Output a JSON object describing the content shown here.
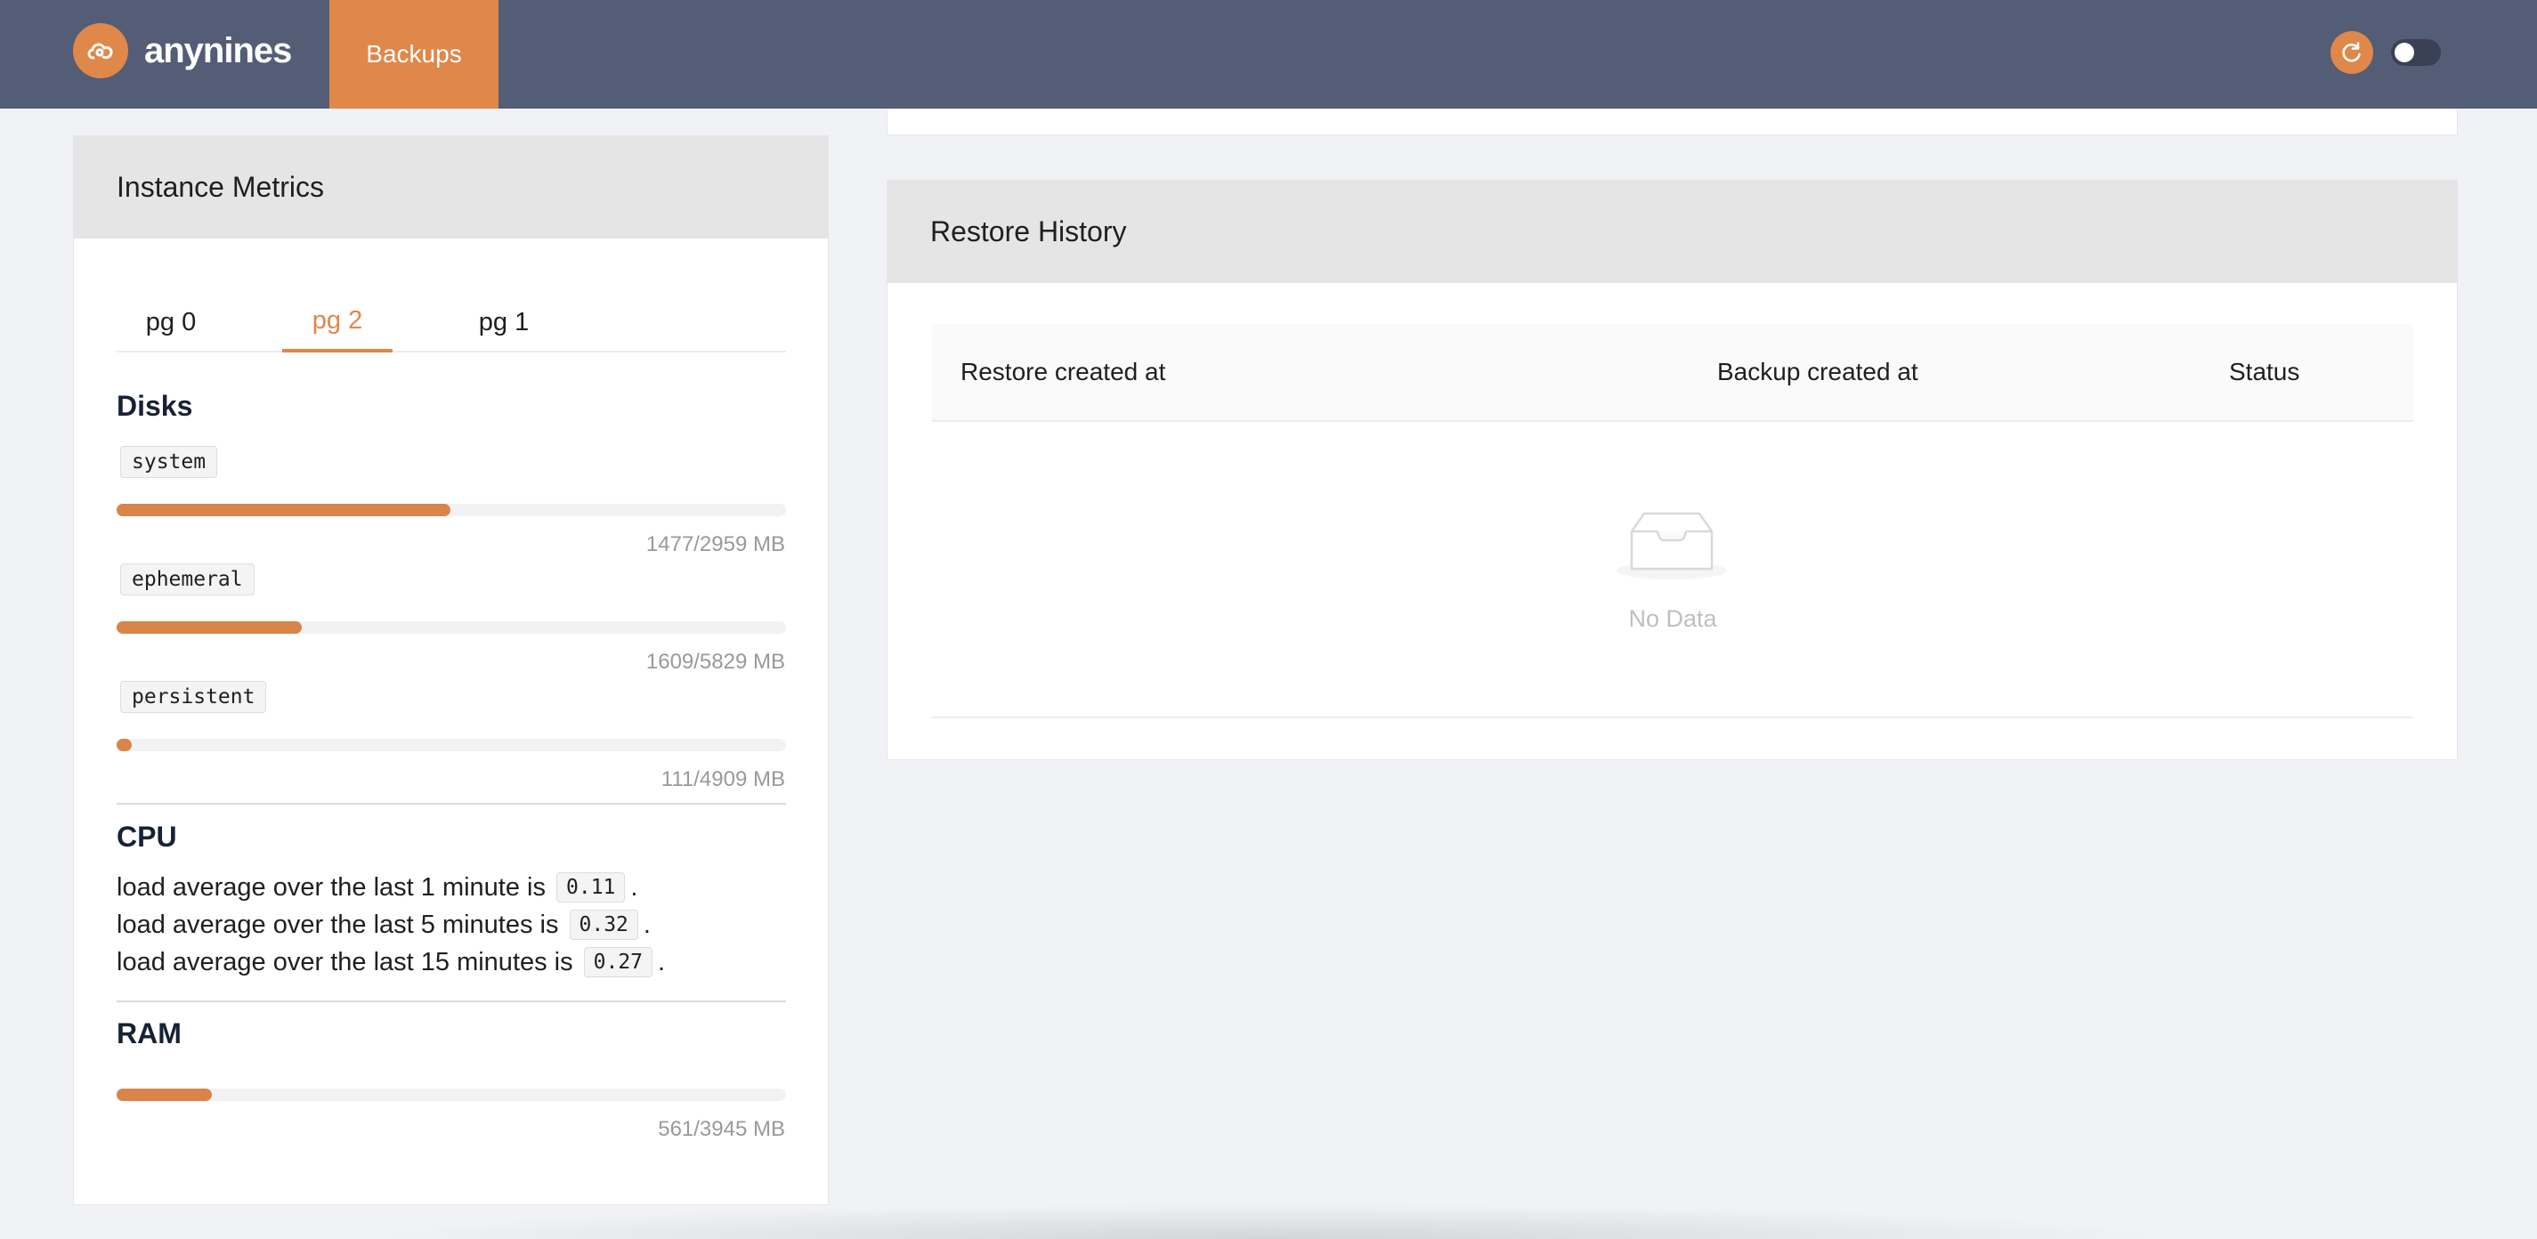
{
  "header": {
    "brand": "anynines",
    "nav_backups": "Backups",
    "refresh_icon": "refresh-icon",
    "theme_toggle_icon": "toggle-icon",
    "colors": {
      "topbar": "#535d76",
      "accent": "#e0874a"
    }
  },
  "metrics": {
    "title": "Instance Metrics",
    "tabs": [
      {
        "label": "pg 0",
        "active": false
      },
      {
        "label": "pg 2",
        "active": true
      },
      {
        "label": "pg 1",
        "active": false
      }
    ],
    "disks": {
      "title": "Disks",
      "items": [
        {
          "name": "system",
          "used": 1477,
          "total": 2959,
          "caption": "1477/2959 MB"
        },
        {
          "name": "ephemeral",
          "used": 1609,
          "total": 5829,
          "caption": "1609/5829 MB"
        },
        {
          "name": "persistent",
          "used": 111,
          "total": 4909,
          "caption": "111/4909 MB"
        }
      ]
    },
    "cpu": {
      "title": "CPU",
      "lines": [
        {
          "prefix": "load average over the last 1 minute is",
          "value": "0.11",
          "suffix": "."
        },
        {
          "prefix": "load average over the last 5 minutes is",
          "value": "0.32",
          "suffix": "."
        },
        {
          "prefix": "load average over the last 15 minutes is",
          "value": "0.27",
          "suffix": "."
        }
      ]
    },
    "ram": {
      "title": "RAM",
      "used": 561,
      "total": 3945,
      "caption": "561/3945 MB"
    }
  },
  "restore": {
    "title": "Restore History",
    "columns": [
      "Restore created at",
      "Backup created at",
      "Status"
    ],
    "empty_icon": "inbox-icon",
    "empty_text": "No Data"
  }
}
